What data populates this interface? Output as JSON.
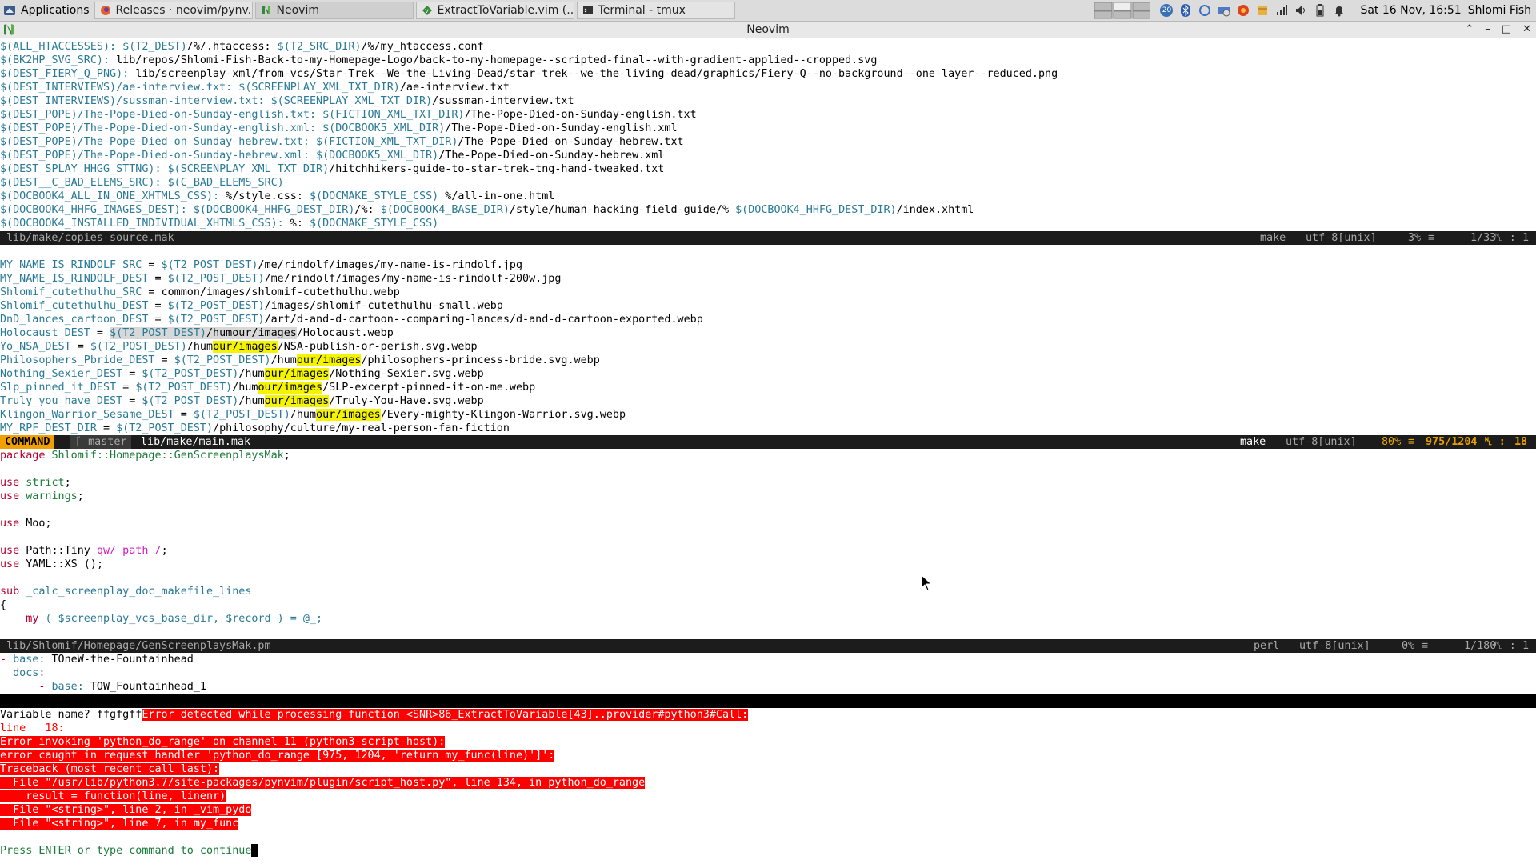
{
  "taskbar": {
    "apps_label": "Applications",
    "tabs": [
      {
        "label": "Releases · neovim/pynv..."
      },
      {
        "label": "Neovim"
      },
      {
        "label": "ExtractToVariable.vim (..."
      },
      {
        "label": "Terminal - tmux"
      }
    ],
    "tray_badge": "20",
    "clock": "Sat 16 Nov, 16:51",
    "user": "Shlomi Fish"
  },
  "window": {
    "title": "Neovim"
  },
  "pane1": {
    "lines": [
      {
        "a": "$(ALL_HTACCESSES): $(T2_DEST)",
        "b": "/%/.htaccess: ",
        "c": "$(T2_SRC_DIR)",
        "d": "/%/my_htaccess.conf"
      },
      {
        "a": "$(BK2HP_SVG_SRC): ",
        "b": "lib/repos/Shlomi-Fish-Back-to-my-Homepage-Logo/back-to-my-homepage--scripted-final--with-gradient-applied--cropped.svg",
        "c": "",
        "d": ""
      },
      {
        "a": "$(DEST_FIERY_Q_PNG): ",
        "b": "lib/screenplay-xml/from-vcs/Star-Trek--We-the-Living-Dead/star-trek--we-the-living-dead/graphics/Fiery-Q--no-background--one-layer--reduced.png",
        "c": "",
        "d": ""
      },
      {
        "a": "$(DEST_INTERVIEWS)/ae-interview.txt: $(SCREENPLAY_XML_TXT_DIR)",
        "b": "/ae-interview.txt",
        "c": "",
        "d": ""
      },
      {
        "a": "$(DEST_INTERVIEWS)/sussman-interview.txt: $(SCREENPLAY_XML_TXT_DIR)",
        "b": "/sussman-interview.txt",
        "c": "",
        "d": ""
      },
      {
        "a": "$(DEST_POPE)/The-Pope-Died-on-Sunday-english.txt: $(FICTION_XML_TXT_DIR)",
        "b": "/The-Pope-Died-on-Sunday-english.txt",
        "c": "",
        "d": ""
      },
      {
        "a": "$(DEST_POPE)/The-Pope-Died-on-Sunday-english.xml: $(DOCBOOK5_XML_DIR)",
        "b": "/The-Pope-Died-on-Sunday-english.xml",
        "c": "",
        "d": ""
      },
      {
        "a": "$(DEST_POPE)/The-Pope-Died-on-Sunday-hebrew.txt: $(FICTION_XML_TXT_DIR)",
        "b": "/The-Pope-Died-on-Sunday-hebrew.txt",
        "c": "",
        "d": ""
      },
      {
        "a": "$(DEST_POPE)/The-Pope-Died-on-Sunday-hebrew.xml: $(DOCBOOK5_XML_DIR)",
        "b": "/The-Pope-Died-on-Sunday-hebrew.xml",
        "c": "",
        "d": ""
      },
      {
        "a": "$(DEST_SPLAY_HHGG_STTNG): $(SCREENPLAY_XML_TXT_DIR)",
        "b": "/hitchhikers-guide-to-star-trek-tng-hand-tweaked.txt",
        "c": "",
        "d": ""
      },
      {
        "a": "$(DEST__C_BAD_ELEMS_SRC): $(C_BAD_ELEMS_SRC)",
        "b": "",
        "c": "",
        "d": ""
      },
      {
        "a": "$(DOCBOOK4_ALL_IN_ONE_XHTMLS_CSS): ",
        "b": "%/style.css: ",
        "c": "$(DOCMAKE_STYLE_CSS)",
        "d": " %/all-in-one.html"
      },
      {
        "a": "$(DOCBOOK4_HHFG_IMAGES_DEST): $(DOCBOOK4_HHFG_DEST_DIR)",
        "b": "/%: ",
        "c": "$(DOCBOOK4_BASE_DIR)",
        "d": "/style/human-hacking-field-guide/% "
      },
      {
        "a": "$(DOCBOOK4_INSTALLED_INDIVIDUAL_XHTMLS_CSS): ",
        "b": "%: ",
        "c": "$(DOCMAKE_STYLE_CSS)",
        "d": ""
      }
    ],
    "line13_tail_var": "$(DOCBOOK4_HHFG_DEST_DIR)",
    "line13_tail": "/index.xhtml",
    "status": {
      "file": "lib/make/copies-source.mak",
      "ft": "make",
      "enc": "utf-8[unix]",
      "pct": "3%",
      "pos": "1/33",
      "col": "1"
    }
  },
  "pane2": {
    "lines": [
      {
        "name": "MY_NAME_IS_RINDOLF_SRC",
        "var": "$(T2_POST_DEST)",
        "pre": "/me/rindolf/images/my-name-is-rindolf.jpg",
        "hl": "",
        "post": ""
      },
      {
        "name": "MY_NAME_IS_RINDOLF_DEST",
        "var": "$(T2_POST_DEST)",
        "pre": "/me/rindolf/images/my-name-is-rindolf-200w.jpg",
        "hl": "",
        "post": ""
      },
      {
        "name": "Shlomif_cutethulhu_SRC",
        "var": "",
        "pre": "common/images/shlomif-cutethulhu.webp",
        "hl": "",
        "post": ""
      },
      {
        "name": "Shlomif_cutethulhu_DEST",
        "var": "$(T2_POST_DEST)",
        "pre": "/images/shlomif-cutethulhu-small.webp",
        "hl": "",
        "post": ""
      },
      {
        "name": "DnD_lances_cartoon_DEST",
        "var": "$(T2_POST_DEST)",
        "pre": "/art/d-and-d-cartoon--comparing-lances/d-and-d-cartoon-exported.webp",
        "hl": "",
        "post": ""
      },
      {
        "name": "Holocaust_DEST",
        "var": "$(T2_POST_DEST)",
        "pre": "/humour/images",
        "hl": "",
        "post": "/Holocaust.webp"
      },
      {
        "name": "Yo_NSA_DEST",
        "var": "$(T2_POST_DEST)",
        "pre": "/hum",
        "hl": "our/images",
        "post": "/NSA-publish-or-perish.svg.webp"
      },
      {
        "name": "Philosophers_Pbride_DEST",
        "var": "$(T2_POST_DEST)",
        "pre": "/hum",
        "hl": "our/images",
        "post": "/philosophers-princess-bride.svg.webp"
      },
      {
        "name": "Nothing_Sexier_DEST",
        "var": "$(T2_POST_DEST)",
        "pre": "/hum",
        "hl": "our/images",
        "post": "/Nothing-Sexier.svg.webp"
      },
      {
        "name": "Slp_pinned_it_DEST",
        "var": "$(T2_POST_DEST)",
        "pre": "/hum",
        "hl": "our/images",
        "post": "/SLP-excerpt-pinned-it-on-me.webp"
      },
      {
        "name": "Truly_you_have_DEST",
        "var": "$(T2_POST_DEST)",
        "pre": "/hum",
        "hl": "our/images",
        "post": "/Truly-You-Have.svg.webp"
      },
      {
        "name": "Klingon_Warrior_Sesame_DEST",
        "var": "$(T2_POST_DEST)",
        "pre": "/hum",
        "hl": "our/images",
        "post": "/Every-mighty-Klingon-Warrior.svg.webp"
      },
      {
        "name": "MY_RPF_DEST_DIR",
        "var": "$(T2_POST_DEST)",
        "pre": "/philosophy/culture/my-real-person-fan-fiction",
        "hl": "",
        "post": ""
      }
    ],
    "status": {
      "mode": "COMMAND",
      "branch": "master",
      "file": "lib/make/main.mak",
      "ft": "make",
      "enc": "utf-8[unix]",
      "pct": "80%",
      "pos": "975/1204",
      "col": "18"
    }
  },
  "pane3": {
    "package_kw": "package",
    "package_name": "Shlomif::Homepage::GenScreenplaysMak",
    "use_kw": "use",
    "strict": "strict",
    "warnings": "warnings",
    "moo": "Moo",
    "path_tiny": "Path::Tiny",
    "qw": "qw/ path /",
    "yaml": "YAML::XS ()",
    "sub_kw": "sub",
    "sub_name": "_calc_screenplay_doc_makefile_lines",
    "brace": "{",
    "my_kw": "my",
    "my_args": "( $screenplay_vcs_base_dir, $record ) = @_;",
    "status": {
      "file": "lib/Shlomif/Homepage/GenScreenplaysMak.pm",
      "ft": "perl",
      "enc": "utf-8[unix]",
      "pct": "0%",
      "pos": "1/180",
      "col": "1"
    }
  },
  "pane4": {
    "l1_dash": "- ",
    "l1_key": "base:",
    "l1_val": " TOneW-the-Fountainhead",
    "l2_key": "docs:",
    "l3_dash": "- ",
    "l3_key": "base:",
    "l3_val": " TOW_Fountainhead_1"
  },
  "messages": {
    "prompt": "Variable name? ffgfgff",
    "err1": "Error detected while processing function <SNR>86_ExtractToVariable[43]..provider#python3#Call:",
    "line": "line   18:",
    "err2": "Error invoking 'python_do_range' on channel 11 (python3-script-host):",
    "err3": "error caught in request handler 'python_do_range [975, 1204, 'return my_func(line)']':",
    "tb": "Traceback (most recent call last):",
    "f1": "  File \"/usr/lib/python3.7/site-packages/pynvim/plugin/script_host.py\", line 134, in python_do_range",
    "f1b": "    result = function(line, linenr)",
    "f2": "  File \"<string>\", line 2, in _vim_pydo",
    "f3": "  File \"<string>\", line 7, in my_func",
    "press": "Press ENTER or type command to continue"
  }
}
